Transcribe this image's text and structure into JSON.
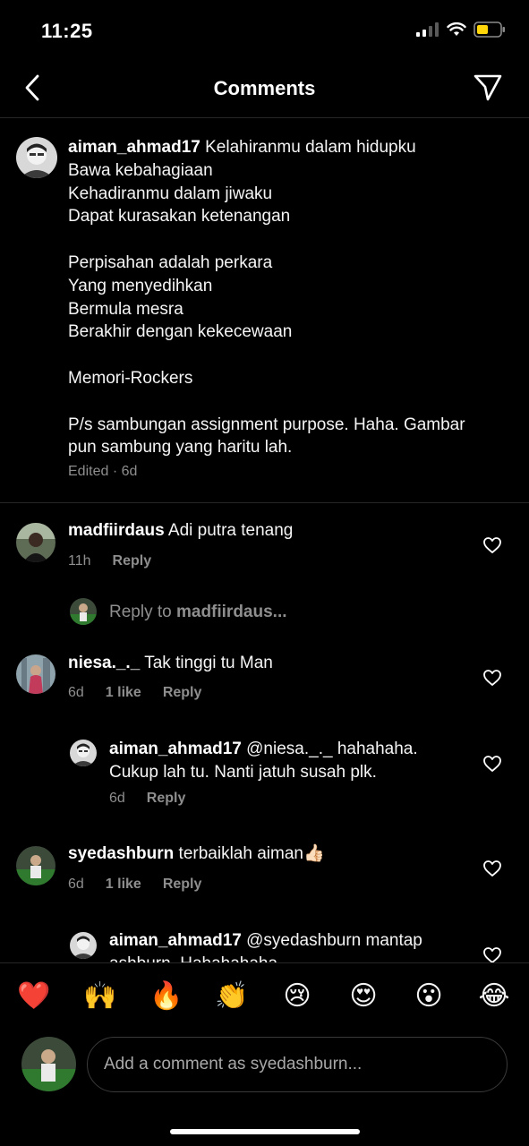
{
  "status_bar": {
    "time": "11:25",
    "icons": [
      "signal-icon",
      "wifi-icon",
      "battery-icon"
    ]
  },
  "header": {
    "title": "Comments",
    "back_icon": "chevron-left-icon",
    "share_icon": "paper-plane-icon"
  },
  "caption": {
    "username": "aiman_ahmad17",
    "text": " Kelahiranmu dalam hidupku\nBawa kebahagiaan\nKehadiranmu dalam jiwaku\nDapat kurasakan ketenangan\n\nPerpisahan adalah perkara\nYang menyedihkan\nBermula mesra\nBerakhir dengan kekecewaan\n\nMemori-Rockers\n\nP/s sambungan assignment purpose. Haha. Gambar pun sambung yang haritu lah.",
    "meta": "Edited · 6d"
  },
  "comments": [
    {
      "username": "madfiirdaus",
      "text": " Adi putra tenang",
      "time": "11h",
      "likes": "",
      "reply_label": "Reply"
    },
    {
      "username": "niesa._._",
      "text": " Tak tinggi tu Man",
      "time": "6d",
      "likes": "1 like",
      "reply_label": "Reply"
    },
    {
      "username": "aiman_ahmad17",
      "text": " @niesa._._ hahahaha. Cukup lah tu. Nanti jatuh susah plk.",
      "time": "6d",
      "likes": "",
      "reply_label": "Reply"
    },
    {
      "username": "syedashburn",
      "text": " terbaiklah aiman👍🏻",
      "time": "6d",
      "likes": "1 like",
      "reply_label": "Reply"
    },
    {
      "username": "aiman_ahmad17",
      "text": " @syedashburn mantap ashburn. Hahahahaha",
      "time": "",
      "likes": "",
      "reply_label": ""
    }
  ],
  "reply_to": {
    "prefix": "Reply to ",
    "username": "madfiirdaus..."
  },
  "emoji_bar": [
    "❤️",
    "🙌",
    "🔥",
    "👏",
    "😢",
    "😍",
    "😮",
    "😂"
  ],
  "composer": {
    "placeholder": "Add a comment as syedashburn..."
  },
  "colors": {
    "background": "#000000",
    "secondary_text": "#8e8e8e",
    "battery": "#ffd60a",
    "divider": "#262626"
  }
}
